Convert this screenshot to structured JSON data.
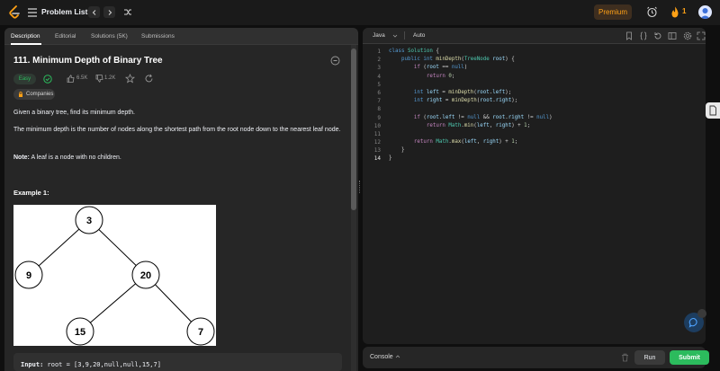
{
  "nav": {
    "problem_list": "Problem List",
    "premium": "Premium",
    "streak_count": "1"
  },
  "tabs": [
    "Description",
    "Editorial",
    "Solutions (5K)",
    "Submissions"
  ],
  "problem": {
    "title": "111. Minimum Depth of Binary Tree",
    "difficulty": "Easy",
    "likes": "6.5K",
    "dislikes": "1.2K",
    "companies_label": "Companies",
    "para1": "Given a binary tree, find its minimum depth.",
    "para2": "The minimum depth is the number of nodes along the shortest path from the root node down to the nearest leaf node.",
    "note_label": "Note:",
    "note_text": " A leaf is a node with no children.",
    "example_heading": "Example 1:",
    "tree_nodes": [
      "3",
      "9",
      "20",
      "15",
      "7"
    ],
    "input_label": "Input:",
    "input_value": " root = [3,9,20,null,null,15,7]"
  },
  "editor": {
    "language": "Java",
    "mode": "Auto",
    "line_numbers": [
      "1",
      "2",
      "3",
      "4",
      "5",
      "6",
      "7",
      "8",
      "9",
      "10",
      "11",
      "12",
      "13",
      "14"
    ],
    "code_lines": [
      "class Solution {",
      "    public int minDepth(TreeNode root) {",
      "        if (root == null)",
      "            return 0;",
      "",
      "        int left = minDepth(root.left);",
      "        int right = minDepth(root.right);",
      "",
      "        if (root.left != null && root.right != null)",
      "            return Math.min(left, right) + 1;",
      "",
      "        return Math.max(left, right) + 1;",
      "    }",
      "}"
    ]
  },
  "console": {
    "label": "Console",
    "run": "Run",
    "submit": "Submit"
  }
}
